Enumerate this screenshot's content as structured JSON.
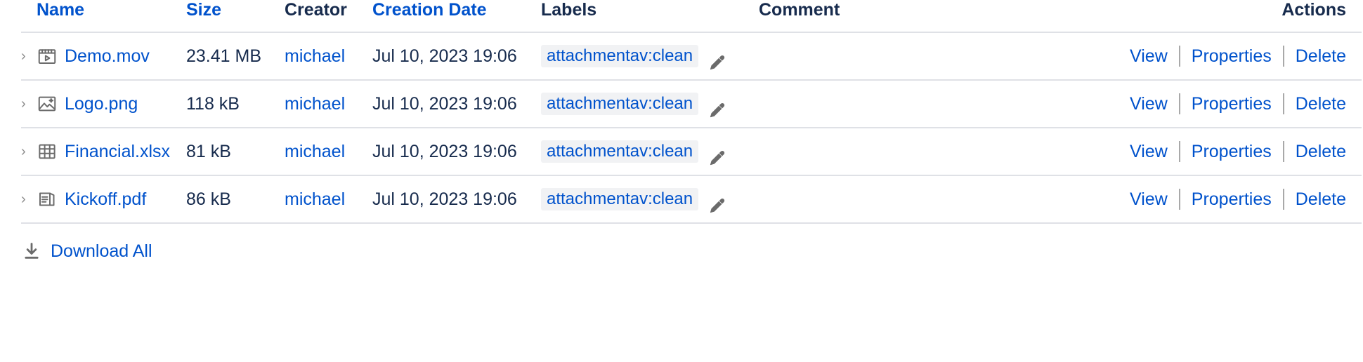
{
  "table": {
    "columns": [
      {
        "key": "name",
        "label": "Name",
        "is_link": true,
        "align": "left"
      },
      {
        "key": "size",
        "label": "Size",
        "is_link": true,
        "align": "left"
      },
      {
        "key": "creator",
        "label": "Creator",
        "is_link": false,
        "align": "left"
      },
      {
        "key": "date",
        "label": "Creation Date",
        "is_link": true,
        "align": "left"
      },
      {
        "key": "labels",
        "label": "Labels",
        "is_link": false,
        "align": "left"
      },
      {
        "key": "comment",
        "label": "Comment",
        "is_link": false,
        "align": "left"
      },
      {
        "key": "actions",
        "label": "Actions",
        "is_link": false,
        "align": "right"
      }
    ],
    "rows": [
      {
        "expand_icon": "chevron-right-icon",
        "file_icon": "movie-file-icon",
        "name": "Demo.mov",
        "size": "23.41 MB",
        "creator": "michael",
        "date": "Jul 10, 2023 19:06",
        "label": "attachmentav:clean",
        "edit_icon": "pencil-icon",
        "comment": "",
        "actions": [
          "View",
          "Properties",
          "Delete"
        ]
      },
      {
        "expand_icon": "chevron-right-icon",
        "file_icon": "image-file-icon",
        "name": "Logo.png",
        "size": "118 kB",
        "creator": "michael",
        "date": "Jul 10, 2023 19:06",
        "label": "attachmentav:clean",
        "edit_icon": "pencil-icon",
        "comment": "",
        "actions": [
          "View",
          "Properties",
          "Delete"
        ]
      },
      {
        "expand_icon": "chevron-right-icon",
        "file_icon": "spreadsheet-file-icon",
        "name": "Financial.xlsx",
        "size": "81 kB",
        "creator": "michael",
        "date": "Jul 10, 2023 19:06",
        "label": "attachmentav:clean",
        "edit_icon": "pencil-icon",
        "comment": "",
        "actions": [
          "View",
          "Properties",
          "Delete"
        ]
      },
      {
        "expand_icon": "chevron-right-icon",
        "file_icon": "pdf-file-icon",
        "name": "Kickoff.pdf",
        "size": "86 kB",
        "creator": "michael",
        "date": "Jul 10, 2023 19:06",
        "label": "attachmentav:clean",
        "edit_icon": "pencil-icon",
        "comment": "",
        "actions": [
          "View",
          "Properties",
          "Delete"
        ]
      }
    ]
  },
  "footer": {
    "download_icon": "download-icon",
    "download_all_label": "Download All"
  },
  "colors": {
    "link": "#0052cc",
    "text": "#172b4d",
    "border": "#dfe1e6",
    "chip_bg": "#f1f2f4",
    "icon_gray": "#6b6b6b"
  }
}
